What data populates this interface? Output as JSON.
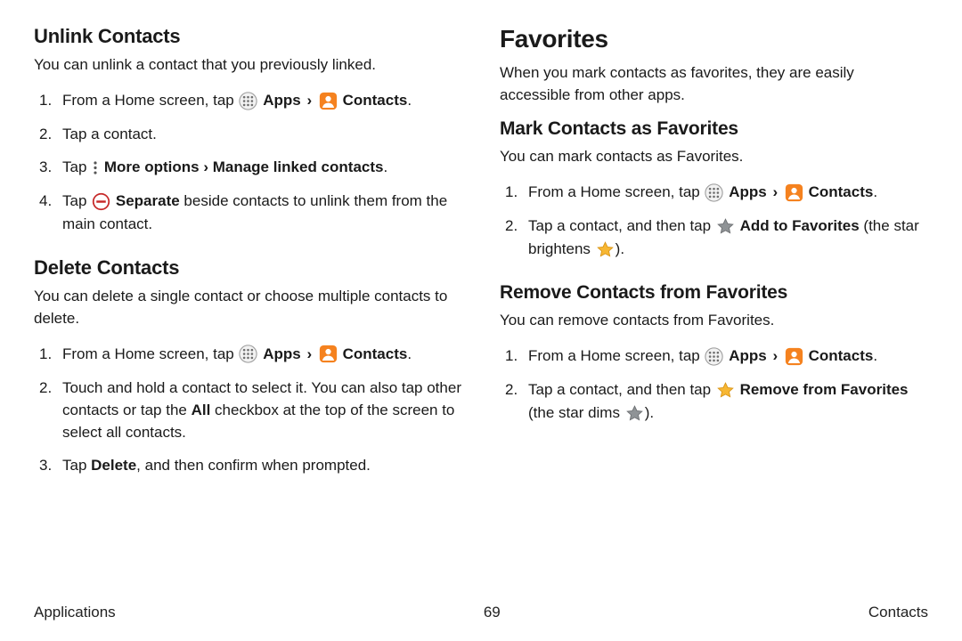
{
  "left": {
    "section1": {
      "heading": "Unlink Contacts",
      "intro": "You can unlink a contact that you previously linked.",
      "steps": {
        "s1a": "From a Home screen, tap ",
        "apps": "Apps",
        "sep": "›",
        "contacts": "Contacts",
        "s1b": ".",
        "s2": "Tap a contact.",
        "s3a": "Tap ",
        "s3b": "More options › Manage linked contacts",
        "s3c": ".",
        "s4a": "Tap ",
        "s4b": "Separate",
        "s4c": " beside contacts to unlink them from the main contact."
      }
    },
    "section2": {
      "heading": "Delete Contacts",
      "intro": "You can delete a single contact or choose multiple contacts to delete.",
      "steps": {
        "s1a": "From a Home screen, tap ",
        "apps": "Apps",
        "sep": "›",
        "contacts": "Contacts",
        "s1b": ".",
        "s2a": "Touch and hold a contact to select it. You can also tap other contacts or tap the ",
        "s2b": "All",
        "s2c": " checkbox at the top of the screen to select all contacts.",
        "s3a": "Tap ",
        "s3b": "Delete",
        "s3c": ", and then confirm when prompted."
      }
    }
  },
  "right": {
    "heading": "Favorites",
    "intro": "When you mark contacts as favorites, they are easily accessible from other apps.",
    "section1": {
      "heading": "Mark Contacts as Favorites",
      "intro": "You can mark contacts as Favorites.",
      "steps": {
        "s1a": "From a Home screen, tap ",
        "apps": "Apps",
        "sep": "›",
        "contacts": "Contacts",
        "s1b": ".",
        "s2a": "Tap a contact, and then tap ",
        "s2b": "Add to Favorites",
        "s2c": " (the star brightens ",
        "s2d": ")."
      }
    },
    "section2": {
      "heading": "Remove Contacts from Favorites",
      "intro": "You can remove contacts from Favorites.",
      "steps": {
        "s1a": "From a Home screen, tap ",
        "apps": "Apps",
        "sep": "›",
        "contacts": "Contacts",
        "s1b": ".",
        "s2a": "Tap a contact, and then tap ",
        "s2b": "Remove from Favorites",
        "s2c": " (the star dims ",
        "s2d": ")."
      }
    }
  },
  "footer": {
    "left": "Applications",
    "center": "69",
    "right": "Contacts"
  }
}
